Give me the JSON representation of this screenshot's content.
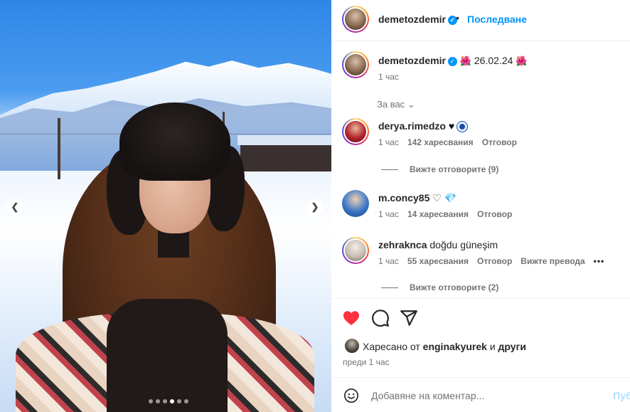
{
  "media": {
    "dots": [
      false,
      false,
      false,
      true,
      false,
      false
    ],
    "nav": {
      "prev_icon": "chevron-left-icon",
      "next_icon": "chevron-right-icon"
    }
  },
  "header": {
    "username": "demetozdemir",
    "verified": true,
    "separator": "•",
    "follow_label": "Последване"
  },
  "caption": {
    "username": "demetozdemir",
    "text": "26.02.24",
    "emoji": "🌺",
    "time": "1 час"
  },
  "for_you_label": "За вас",
  "comments": [
    {
      "username": "derya.rimedzo",
      "time": "1 час",
      "likes": "142 харесвания",
      "reply_label": "Отговор",
      "view_replies": "Вижте отговорите (9)"
    },
    {
      "username": "m.concy85",
      "time": "1 час",
      "likes": "14 харесвания",
      "reply_label": "Отговор"
    },
    {
      "username": "zehrakncа",
      "text": "doğdu güneşim",
      "time": "1 час",
      "likes": "55 харесвания",
      "reply_label": "Отговор",
      "translate_label": "Вижте превода",
      "more_label": "•••",
      "view_replies": "Вижте отговорите (2)"
    }
  ],
  "actions": {
    "like_icon": "heart-filled-icon",
    "comment_icon": "comment-icon",
    "share_icon": "share-icon",
    "like_color": "#ff3040"
  },
  "likes": {
    "prefix": "Харесано от",
    "user": "enginakyurek",
    "conj": "и",
    "others": "други"
  },
  "post_time": "преди 1 час",
  "add_comment": {
    "placeholder": "Добавяне на коментар...",
    "post_label": "Пуб"
  },
  "colors": {
    "accent": "#0095f6",
    "muted": "#737373",
    "text": "#262626"
  }
}
